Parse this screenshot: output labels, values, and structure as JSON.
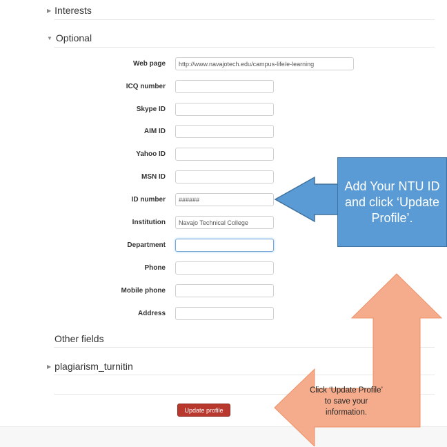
{
  "sections": {
    "interests": "Interests",
    "optional": "Optional",
    "other_fields": "Other fields",
    "plagiarism": "plagiarism_turnitin"
  },
  "fields": [
    {
      "label": "Web page",
      "value": "http://www.navajotech.edu/campus-life/e-learning"
    },
    {
      "label": "ICQ number",
      "value": ""
    },
    {
      "label": "Skype ID",
      "value": ""
    },
    {
      "label": "AIM ID",
      "value": ""
    },
    {
      "label": "Yahoo ID",
      "value": ""
    },
    {
      "label": "MSN ID",
      "value": ""
    },
    {
      "label": "ID number",
      "value": "######"
    },
    {
      "label": "Institution",
      "value": "Navajo Technical College"
    },
    {
      "label": "Department",
      "value": ""
    },
    {
      "label": "Phone",
      "value": ""
    },
    {
      "label": "Mobile phone",
      "value": ""
    },
    {
      "label": "Address",
      "value": ""
    }
  ],
  "update_button": "Update profile",
  "callout_blue": "Add Your NTU ID and click ‘Update Profile’.",
  "callout_orange": {
    "line1": "Click ‘Update Profile’",
    "line2": "to save your",
    "line3": "information."
  },
  "colors": {
    "callout_blue": "#5b9bd5",
    "callout_orange": "#f4a582",
    "update_button": "#b8382e"
  }
}
